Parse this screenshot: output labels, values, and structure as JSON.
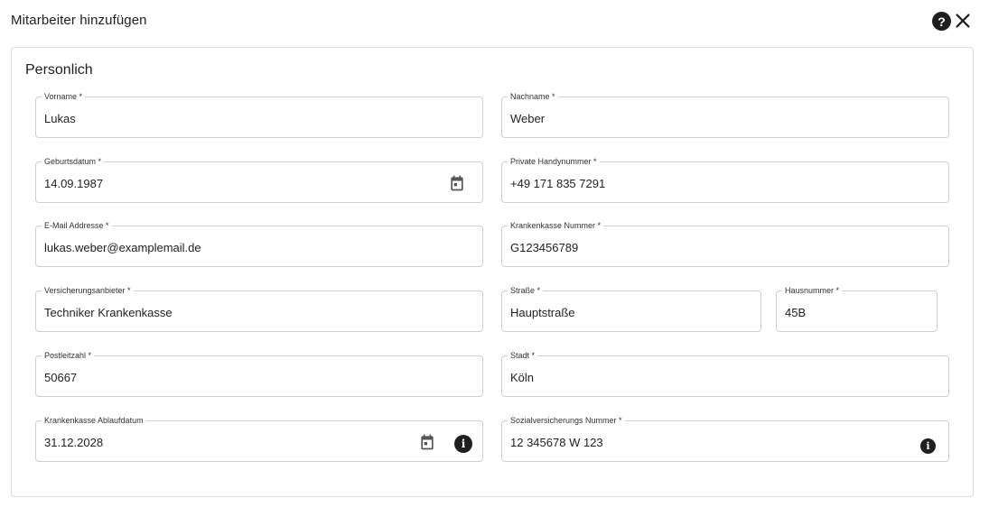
{
  "dialog": {
    "title": "Mitarbeiter hinzufügen",
    "help_icon": "help-circle-icon",
    "close_icon": "close-icon"
  },
  "section": {
    "title": "Personlich"
  },
  "fields": {
    "vorname": {
      "label": "Vorname *",
      "value": "Lukas"
    },
    "nachname": {
      "label": "Nachname *",
      "value": "Weber"
    },
    "geburtsdatum": {
      "label": "Geburtsdatum *",
      "value": "14.09.1987",
      "icon": "calendar-icon"
    },
    "handynummer": {
      "label": "Private Handynummer *",
      "value": "+49 171 835 7291"
    },
    "email": {
      "label": "E-Mail Addresse *",
      "value": "lukas.weber@examplemail.de"
    },
    "krankenkasse_nummer": {
      "label": "Krankenkasse Nummer *",
      "value": "G123456789"
    },
    "versicherungsanbieter": {
      "label": "Versicherungsanbieter *",
      "value": "Techniker Krankenkasse"
    },
    "strasse": {
      "label": "Straße *",
      "value": "Hauptstraße"
    },
    "hausnummer": {
      "label": "Hausnummer *",
      "value": "45B"
    },
    "postleitzahl": {
      "label": "Postleitzahl *",
      "value": "50667"
    },
    "stadt": {
      "label": "Stadt *",
      "value": "Köln"
    },
    "ablaufdatum": {
      "label": "Krankenkasse Ablaufdatum",
      "value": "31.12.2028",
      "icon": "calendar-icon",
      "info_icon": "info-icon"
    },
    "sozialversicherung": {
      "label": "Sozialversicherungs Nummer *",
      "value": "12 345678 W 123",
      "info_icon": "info-icon"
    }
  }
}
